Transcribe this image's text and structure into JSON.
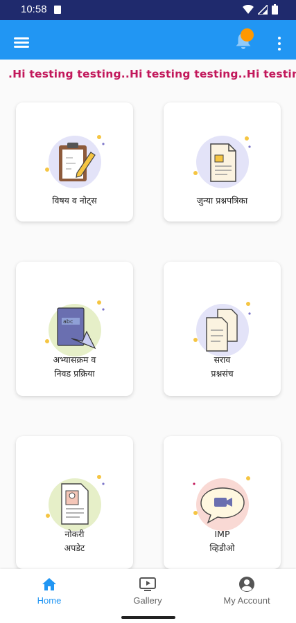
{
  "status_bar": {
    "time": "10:58"
  },
  "marquee": {
    "text": ".Hi testing testing..Hi testing testing..Hi testing testing.."
  },
  "cards": [
    {
      "label": "विषय व नोट्स",
      "icon": "clipboard-pencil-icon"
    },
    {
      "label": "जुन्या प्रश्नपत्रिका",
      "icon": "document-icon"
    },
    {
      "label_line1": "अभ्यासक्रम व",
      "label_line2": "निवड प्रक्रिया",
      "icon": "book-pen-icon"
    },
    {
      "label_line1": "सराव",
      "label_line2": "प्रश्नसंच",
      "icon": "documents-icon"
    },
    {
      "label_line1": "नोकरी",
      "label_line2": "अपडेट",
      "icon": "resume-icon"
    },
    {
      "label_line1": "IMP",
      "label_line2": "व्हिडीओ",
      "icon": "video-chat-icon"
    }
  ],
  "bottom_nav": [
    {
      "label": "Home",
      "icon": "home-icon",
      "active": true
    },
    {
      "label": "Gallery",
      "icon": "tv-icon",
      "active": false
    },
    {
      "label": "My Account",
      "icon": "account-icon",
      "active": false
    }
  ],
  "colors": {
    "status_bar": "#1f2a6d",
    "app_bar": "#2196f3",
    "marquee_text": "#c2185b",
    "badge": "#ff9800",
    "active_nav": "#2196f3"
  }
}
